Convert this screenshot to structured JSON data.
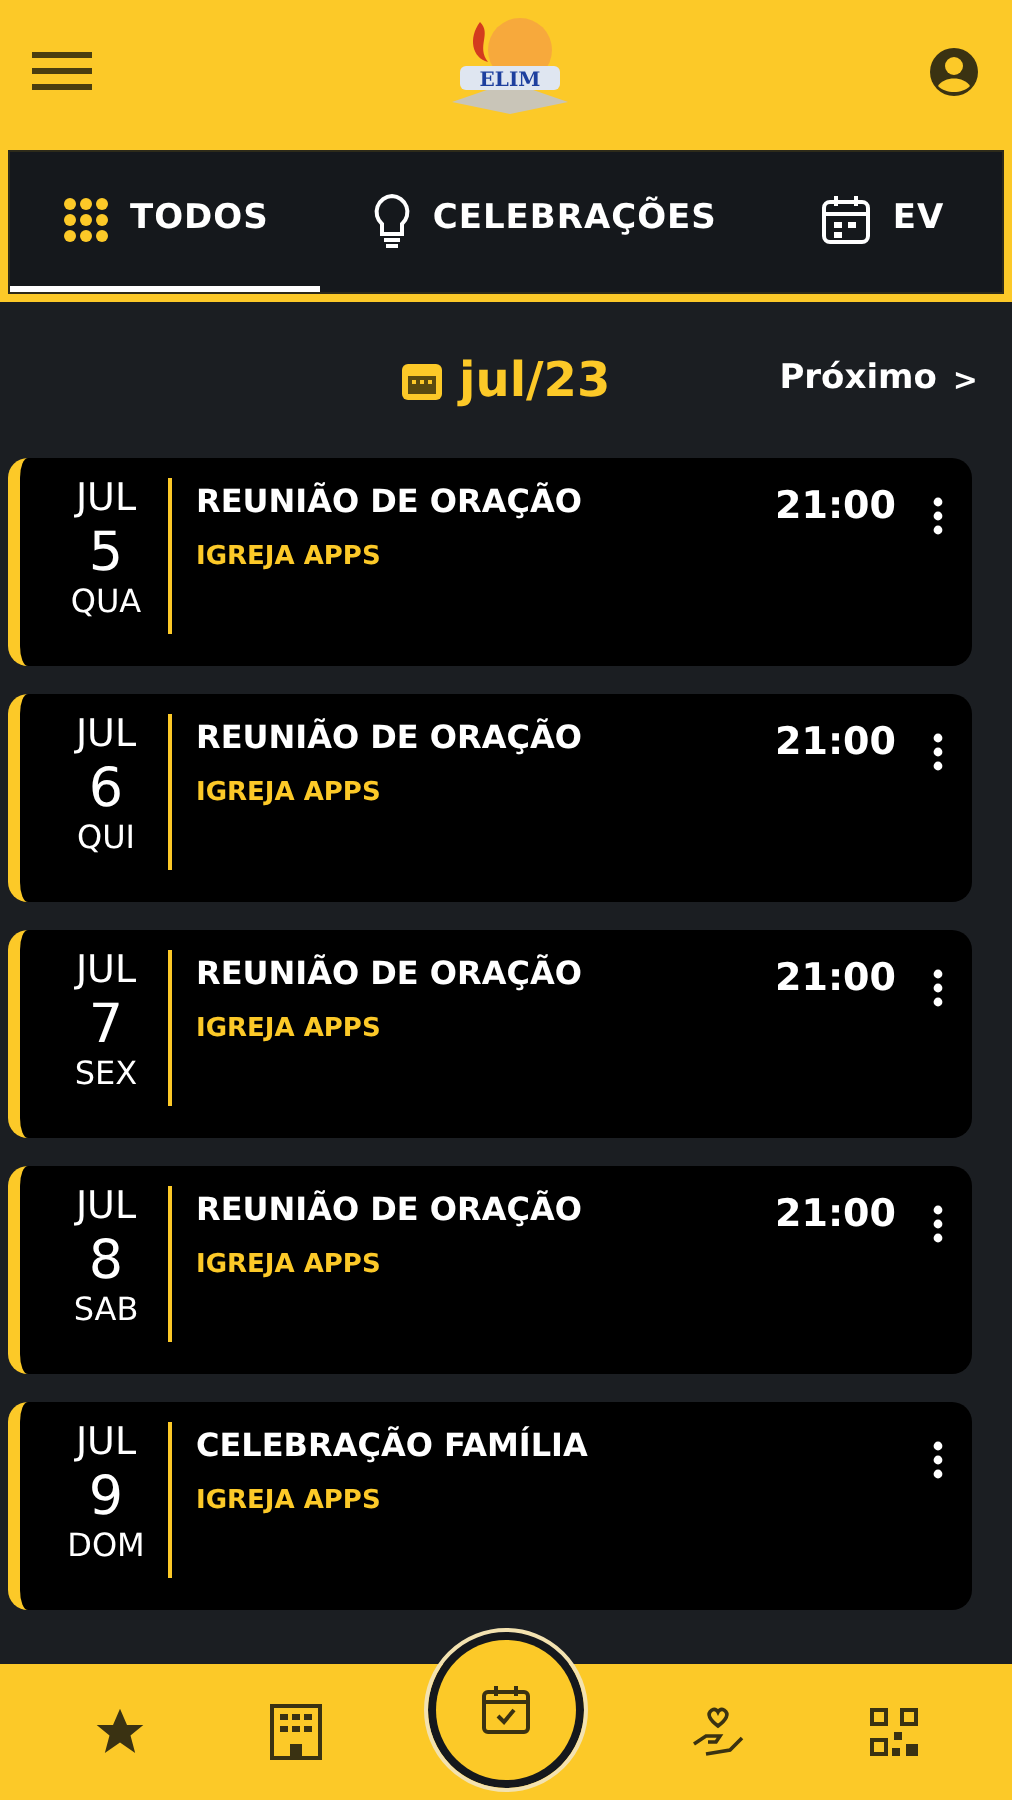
{
  "header": {
    "logo_text": "ELIM"
  },
  "tabs": [
    {
      "label": "TODOS",
      "kind": "grid",
      "selected": true
    },
    {
      "label": "CELEBRAÇÕES",
      "kind": "bulb",
      "selected": false
    },
    {
      "label": "EV",
      "kind": "calendar",
      "selected": false
    }
  ],
  "month": {
    "label": "jul/23",
    "next": "Próximo",
    "next_icon": ">"
  },
  "events": [
    {
      "month": "JUL",
      "day": "5",
      "weekday": "QUA",
      "title": "REUNIÃO DE ORAÇÃO",
      "church": "IGREJA APPS",
      "time": "21:00"
    },
    {
      "month": "JUL",
      "day": "6",
      "weekday": "QUI",
      "title": "REUNIÃO DE ORAÇÃO",
      "church": "IGREJA APPS",
      "time": "21:00"
    },
    {
      "month": "JUL",
      "day": "7",
      "weekday": "SEX",
      "title": "REUNIÃO DE ORAÇÃO",
      "church": "IGREJA APPS",
      "time": "21:00"
    },
    {
      "month": "JUL",
      "day": "8",
      "weekday": "SAB",
      "title": "REUNIÃO DE ORAÇÃO",
      "church": "IGREJA APPS",
      "time": "21:00"
    },
    {
      "month": "JUL",
      "day": "9",
      "weekday": "DOM",
      "title": "CELEBRAÇÃO FAMÍLIA",
      "church": "IGREJA APPS"
    }
  ],
  "bottom_nav": [
    {
      "kind": "star",
      "selected": false
    },
    {
      "kind": "building",
      "selected": false
    },
    {
      "kind": "calendar-check",
      "selected": true
    },
    {
      "kind": "hand-heart",
      "selected": false
    },
    {
      "kind": "qr",
      "selected": false
    }
  ]
}
